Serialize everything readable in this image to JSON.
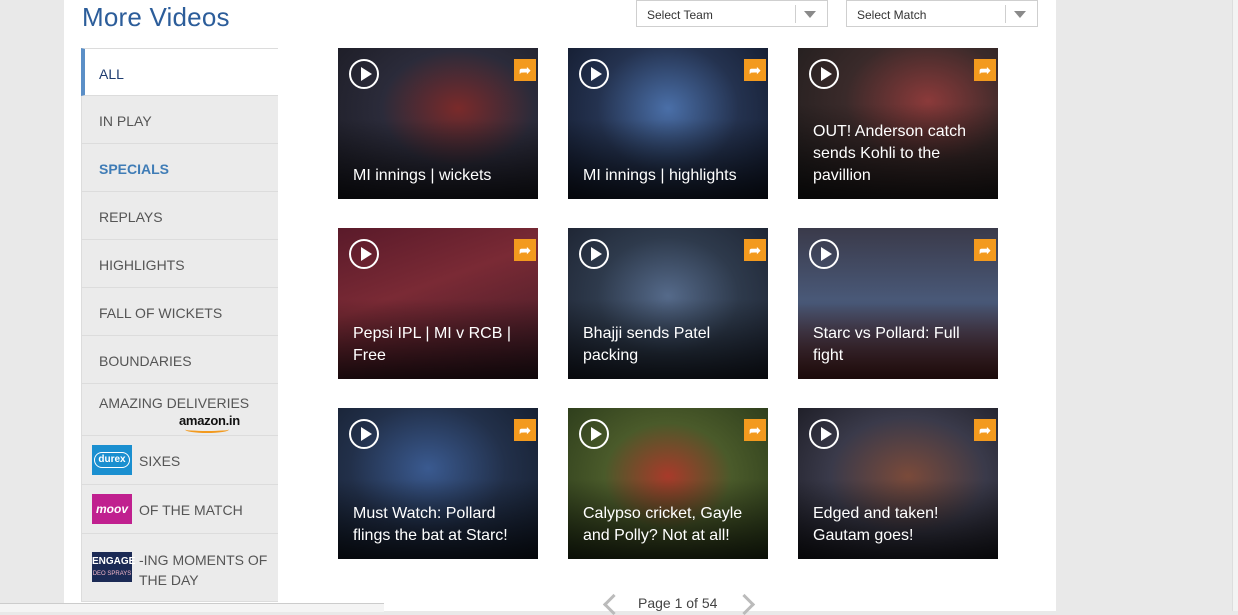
{
  "header": {
    "title": "More Videos",
    "team_select": "Select Team",
    "match_select": "Select Match"
  },
  "sidebar": {
    "items": [
      {
        "label": "ALL"
      },
      {
        "label": "IN PLAY"
      },
      {
        "label": "SPECIALS"
      },
      {
        "label": "REPLAYS"
      },
      {
        "label": "HIGHLIGHTS"
      },
      {
        "label": "FALL OF WICKETS"
      },
      {
        "label": "BOUNDARIES"
      },
      {
        "label": "AMAZING DELIVERIES",
        "sponsor": "amazon.in"
      },
      {
        "label": "SIXES",
        "sponsor": "durex"
      },
      {
        "label": "OF THE MATCH",
        "sponsor": "moov"
      },
      {
        "label": "-ING MOMENTS OF THE DAY",
        "sponsor": "ENGAGE",
        "sponsor_sub": "DEO SPRAYS"
      }
    ]
  },
  "videos": [
    {
      "caption": "MI innings | wickets"
    },
    {
      "caption": "MI innings | highlights"
    },
    {
      "caption": "OUT! Anderson catch sends Kohli to the pavillion"
    },
    {
      "caption": "Pepsi IPL | MI v RCB | Free"
    },
    {
      "caption": "Bhajji sends Patel packing"
    },
    {
      "caption": "Starc vs Pollard: Full fight"
    },
    {
      "caption": "Must Watch: Pollard flings the bat at Starc!"
    },
    {
      "caption": "Calypso cricket, Gayle and Polly? Not at all!"
    },
    {
      "caption": "Edged and taken! Gautam goes!"
    }
  ],
  "pager": {
    "label": "Page 1 of 54"
  },
  "colors": {
    "accent": "#2c5d9a",
    "share": "#f39a1e",
    "active_bar": "#5b8fc7"
  }
}
